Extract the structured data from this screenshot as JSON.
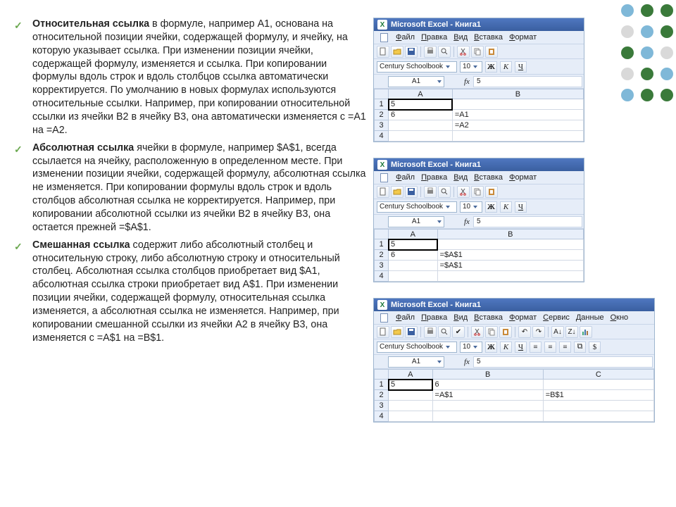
{
  "bullets": [
    {
      "term": "Относительная ссылка",
      "rest": " в формуле, например A1, основана на относительной позиции ячейки, содержащей формулу, и ячейку, на которую указывает ссылка. При изменении позиции ячейки, содержащей формулу, изменяется и ссылка. При копировании формулы вдоль строк и вдоль столбцов ссылка автоматически корректируется. По умолчанию в новых формулах используются относительные ссылки. Например, при копировании относительной ссылки из ячейки B2 в ячейку B3, она автоматически изменяется с =A1 на =A2."
    },
    {
      "term": "Абсолютная ссылка",
      "rest": "  ячейки в формуле, например $A$1, всегда ссылается на ячейку, расположенную в определенном месте. При изменении позиции ячейки, содержащей формулу, абсолютная ссылка не изменяется. При копировании формулы вдоль строк и вдоль столбцов абсолютная ссылка не корректируется. Например, при копировании абсолютной ссылки из ячейки B2 в ячейку B3, она остается прежней =$A$1."
    },
    {
      "term": "Смешанная ссылка",
      "rest": " содержит либо абсолютный столбец и относительную строку, либо абсолютную строку и относительный столбец. Абсолютная ссылка столбцов приобретает вид $A1, абсолютная ссылка строки приобретает вид A$1. При изменении позиции ячейки, содержащей формулу, относительная ссылка изменяется, а абсолютная ссылка не изменяется. Например, при копировании смешанной ссылки из ячейки A2 в ячейку B3, она изменяется с =A$1 на =B$1."
    }
  ],
  "excel_common": {
    "title": "Microsoft Excel - Книга1",
    "menus": {
      "file": "Файл",
      "edit": "Правка",
      "view": "Вид",
      "insert": "Вставка",
      "format": "Формат",
      "tools": "Сервис",
      "data": "Данные",
      "window": "Окно"
    },
    "font_name": "Century Schoolbook",
    "font_size": "10",
    "bold": "Ж",
    "italic": "К",
    "uline": "Ч",
    "namebox": "A1",
    "fx_label": "fx",
    "fx_value": "5",
    "cols2": [
      "A",
      "B"
    ],
    "cols3": [
      "A",
      "B",
      "C"
    ],
    "rows": [
      "1",
      "2",
      "3",
      "4"
    ]
  },
  "shot1_cells": {
    "r1": {
      "A": "5",
      "B": ""
    },
    "r2": {
      "A": "6",
      "B": "=A1"
    },
    "r3": {
      "A": "",
      "B": "=A2"
    },
    "r4": {
      "A": "",
      "B": ""
    }
  },
  "shot2_cells": {
    "r1": {
      "A": "5",
      "B": ""
    },
    "r2": {
      "A": "6",
      "B": "=$A$1"
    },
    "r3": {
      "A": "",
      "B": "=$A$1"
    },
    "r4": {
      "A": "",
      "B": ""
    }
  },
  "shot3_cells": {
    "r1": {
      "A": "5",
      "B": "6",
      "C": ""
    },
    "r2": {
      "A": "",
      "B": "=A$1",
      "C": "=B$1"
    },
    "r3": {
      "A": "",
      "B": "",
      "C": ""
    },
    "r4": {
      "A": "",
      "B": "",
      "C": ""
    }
  },
  "dots_colors": [
    [
      "#7fb8d8",
      "#3a7a3a",
      "#3a7a3a"
    ],
    [
      "#d9d9d9",
      "#7fb8d8",
      "#3a7a3a"
    ],
    [
      "#3a7a3a",
      "#7fb8d8",
      "#d9d9d9"
    ],
    [
      "#d9d9d9",
      "#3a7a3a",
      "#7fb8d8"
    ],
    [
      "#7fb8d8",
      "#3a7a3a",
      "#3a7a3a"
    ]
  ]
}
